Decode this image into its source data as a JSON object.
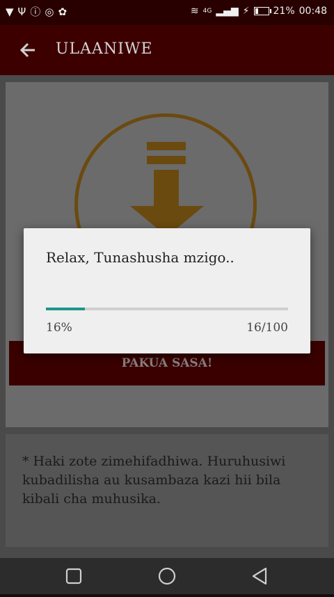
{
  "status_bar": {
    "left_icons": [
      "signal-app-icon",
      "usb-icon",
      "bolt-circle-icon",
      "hotspot-icon",
      "android-icon"
    ],
    "battery_percent": "21%",
    "time": "00:48",
    "battery_level": 0.21,
    "network_type": "4G"
  },
  "app_bar": {
    "title": "ULAANIWE",
    "back_icon": "arrow-left-icon"
  },
  "main": {
    "download_icon": "download-arrow-icon",
    "download_button_label": "PAKUA SASA!",
    "notice_text": "* Haki zote zimehifadhiwa. Huruhusiwi kubadilisha au kusambaza kazi hii bila kibali cha muhusika."
  },
  "dialog": {
    "message": "Relax, Tunashusha mzigo..",
    "progress_fraction": 0.16,
    "progress_percent": "16%",
    "progress_count": "16/100"
  },
  "colors": {
    "app_bar": "#3d0000",
    "accent_progress": "#1f968b",
    "icon_brown": "#6b4a10"
  },
  "nav_bar": {
    "buttons": [
      "recents-icon",
      "home-icon",
      "back-triangle-icon"
    ]
  }
}
